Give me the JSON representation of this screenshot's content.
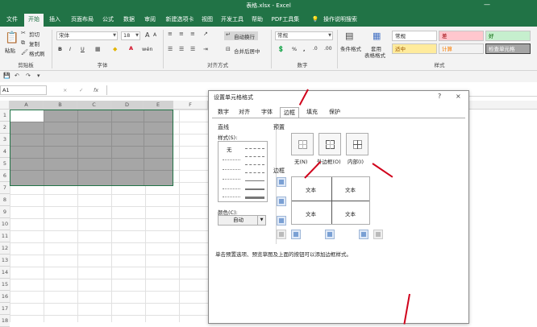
{
  "window": {
    "title": "表格.xlsx - Excel"
  },
  "tabs": [
    "文件",
    "开始",
    "插入",
    "页面布局",
    "公式",
    "数据",
    "审阅",
    "新建选项卡",
    "视图",
    "开发工具",
    "帮助",
    "PDF工具集",
    "操作说明搜索"
  ],
  "ribbon": {
    "clipboard": {
      "paste": "粘贴",
      "cut": "剪切",
      "copy": "复制",
      "format_painter": "格式刷",
      "label": "剪贴板"
    },
    "font": {
      "name": "宋体",
      "size": "18",
      "label": "字体",
      "bold": "B",
      "italic": "I",
      "underline": "U",
      "grow": "A",
      "shrink": "A",
      "font_color": "A",
      "wen": "wén"
    },
    "alignment": {
      "wrap": "自动换行",
      "merge": "合并后居中",
      "label": "对齐方式"
    },
    "number": {
      "format": "常规",
      "label": "数字",
      "percent": "%",
      "comma": ",",
      "inc": ".0",
      "dec": ".00"
    },
    "styles": {
      "conditional": "条件格式",
      "table": "套用\n表格格式",
      "table_line1": "套用",
      "table_line2": "表格格式",
      "label": "样式",
      "normal": "常规",
      "bad": "差",
      "good": "好",
      "neutral": "适中",
      "calc": "计算",
      "check": "检查单元格"
    }
  },
  "formula_bar": {
    "name_box": "A1",
    "fx": "fx",
    "cancel": "×",
    "enter": "✓"
  },
  "columns": [
    "A",
    "B",
    "C",
    "D",
    "E",
    "F"
  ],
  "rows": [
    "1",
    "2",
    "3",
    "4",
    "5",
    "6",
    "7",
    "8",
    "9",
    "10",
    "11",
    "12",
    "13",
    "14",
    "15",
    "16",
    "17",
    "18"
  ],
  "dialog": {
    "title": "设置单元格格式",
    "help": "?",
    "close": "×",
    "tabs": [
      "数字",
      "对齐",
      "字体",
      "边框",
      "填充",
      "保护"
    ],
    "line_section": "直线",
    "style_label": "样式(S):",
    "none_label": "无",
    "color_label": "颜色(C):",
    "color_value": "自动",
    "presets_label": "预置",
    "presets": [
      "无(N)",
      "外边框(O)",
      "内部(I)"
    ],
    "border_label": "边框",
    "preview_texts": [
      "文本",
      "文本",
      "文本",
      "文本"
    ],
    "hint": "单击预置选项、预览草图及上面的按钮可以添加边框样式。"
  },
  "colors": {
    "excel_green": "#217346",
    "annotation_red": "#d0021b",
    "bad_bg": "#ffc7ce",
    "good_bg": "#c6efce",
    "neutral_bg": "#ffeb9c"
  }
}
